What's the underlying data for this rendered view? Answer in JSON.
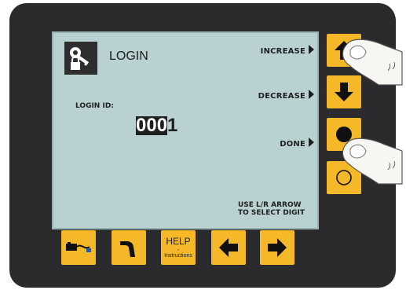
{
  "screen": {
    "title": "LOGIN",
    "login_id_label": "LOGIN ID:",
    "login_id_inverted_digits": "000",
    "login_id_selected_digit": "1",
    "softkeys": {
      "increase": "INCREASE",
      "decrease": "DECREASE",
      "done": "DONE"
    },
    "hint_line1": "USE L/R ARROW",
    "hint_line2": "TO SELECT DIGIT"
  },
  "help_button": {
    "line1": "HELP",
    "line2": "-",
    "line3": "Instructions"
  },
  "icons": {
    "login": "keys-lock-icon",
    "increase": "arrow-up-icon",
    "decrease": "arrow-down-icon",
    "done": "filled-circle-icon",
    "fourth": "hollow-circle-icon",
    "bottom1": "machine-icon",
    "bottom2": "welding-gun-icon",
    "left": "arrow-left-icon",
    "right": "arrow-right-icon"
  },
  "colors": {
    "button": "#f4b829",
    "screen": "#b9d2d1",
    "housing": "#2b2b2d"
  }
}
